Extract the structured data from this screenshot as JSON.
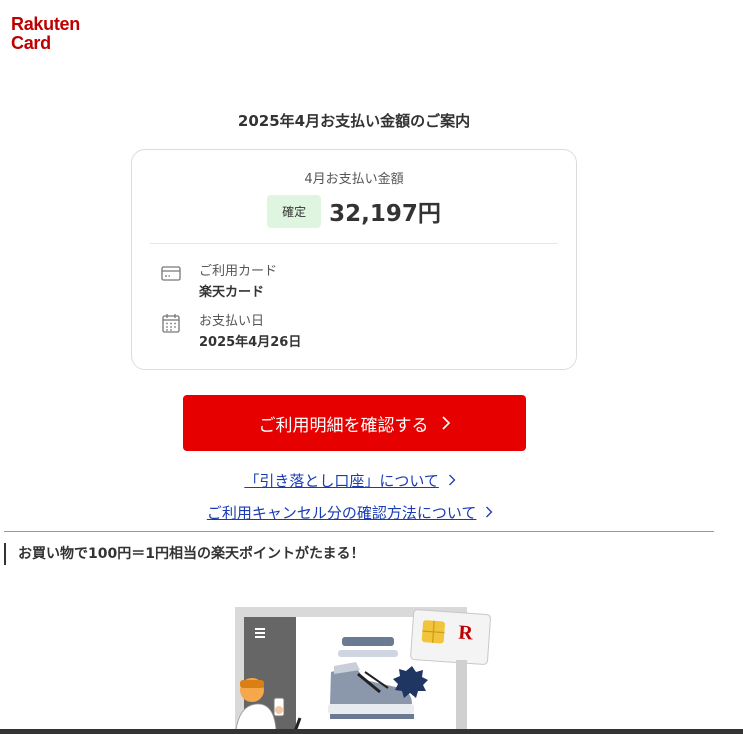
{
  "logo": {
    "line1": "Rakuten",
    "line2": "Card"
  },
  "header": {
    "title": "2025年4月お支払い金額のご案内"
  },
  "summary": {
    "amount_label": "4月お支払い金額",
    "status_badge": "確定",
    "amount": "32,197円",
    "card_label": "ご利用カード",
    "card_value": "楽天カード",
    "date_label": "お支払い日",
    "date_value": "2025年4月26日"
  },
  "actions": {
    "cta_label": "ご利用明細を確認する",
    "link1": "「引き落とし口座」について",
    "link2": "ご利用キャンセル分の確認方法について"
  },
  "promo": {
    "heading": "お買い物で100円＝1円相当の楽天ポイントがたまる！",
    "card_logo_letter": "R"
  },
  "colors": {
    "brand": "#bf0000",
    "cta": "#e60000",
    "link": "#1a3bb3",
    "badge_bg": "#dff5df"
  },
  "icons": {
    "card": "credit-card-icon",
    "calendar": "calendar-icon",
    "chevron": "chevron-right-icon"
  }
}
